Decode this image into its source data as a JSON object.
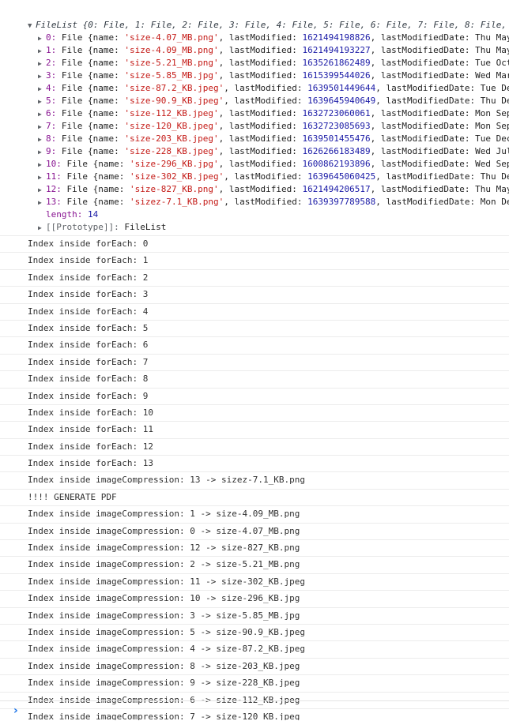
{
  "filelist": {
    "header": "FileList {0: File, 1: File, 2: File, 3: File, 4: File, 5: File, 6: File, 7: File, 8: File,",
    "entries": [
      {
        "index": "0",
        "name": "'size-4.07_MB.png'",
        "lastModified": "1621494198826",
        "date": "Thu May"
      },
      {
        "index": "1",
        "name": "'size-4.09_MB.png'",
        "lastModified": "1621494193227",
        "date": "Thu May"
      },
      {
        "index": "2",
        "name": "'size-5.21_MB.png'",
        "lastModified": "1635261862489",
        "date": "Tue Oct"
      },
      {
        "index": "3",
        "name": "'size-5.85_MB.jpg'",
        "lastModified": "1615399544026",
        "date": "Wed Mar"
      },
      {
        "index": "4",
        "name": "'size-87.2_KB.jpeg'",
        "lastModified": "1639501449644",
        "date": "Tue De"
      },
      {
        "index": "5",
        "name": "'size-90.9_KB.jpeg'",
        "lastModified": "1639645940649",
        "date": "Thu De"
      },
      {
        "index": "6",
        "name": "'size-112_KB.jpeg'",
        "lastModified": "1632723060061",
        "date": "Mon Sep"
      },
      {
        "index": "7",
        "name": "'size-120_KB.jpeg'",
        "lastModified": "1632723085693",
        "date": "Mon Sep"
      },
      {
        "index": "8",
        "name": "'size-203_KB.jpeg'",
        "lastModified": "1639501455476",
        "date": "Tue Dec"
      },
      {
        "index": "9",
        "name": "'size-228_KB.jpeg'",
        "lastModified": "1626266183489",
        "date": "Wed Jul"
      },
      {
        "index": "10",
        "name": "'size-296_KB.jpg'",
        "lastModified": "1600862193896",
        "date": "Wed Sep"
      },
      {
        "index": "11",
        "name": "'size-302_KB.jpeg'",
        "lastModified": "1639645060425",
        "date": "Thu De"
      },
      {
        "index": "12",
        "name": "'size-827_KB.png'",
        "lastModified": "1621494206517",
        "date": "Thu May"
      },
      {
        "index": "13",
        "name": "'sizez-7.1_KB.png'",
        "lastModified": "1639397789588",
        "date": "Mon De"
      }
    ],
    "length_label": "length:",
    "length_value": "14",
    "proto_label": "[[Prototype]]:",
    "proto_value": "FileList"
  },
  "logs": [
    "Index inside forEach: 0",
    "Index inside forEach: 1",
    "Index inside forEach: 2",
    "Index inside forEach: 3",
    "Index inside forEach: 4",
    "Index inside forEach: 5",
    "Index inside forEach: 6",
    "Index inside forEach: 7",
    "Index inside forEach: 8",
    "Index inside forEach: 9",
    "Index inside forEach: 10",
    "Index inside forEach: 11",
    "Index inside forEach: 12",
    "Index inside forEach: 13",
    "Index inside imageCompression: 13 -> sizez-7.1_KB.png",
    "!!!! GENERATE PDF",
    "Index inside imageCompression: 1 -> size-4.09_MB.png",
    "Index inside imageCompression: 0 -> size-4.07_MB.png",
    "Index inside imageCompression: 12 -> size-827_KB.png",
    "Index inside imageCompression: 2 -> size-5.21_MB.png",
    "Index inside imageCompression: 11 -> size-302_KB.jpeg",
    "Index inside imageCompression: 10 -> size-296_KB.jpg",
    "Index inside imageCompression: 3 -> size-5.85_MB.jpg",
    "Index inside imageCompression: 5 -> size-90.9_KB.jpeg",
    "Index inside imageCompression: 4 -> size-87.2_KB.jpeg",
    "Index inside imageCompression: 8 -> size-203_KB.jpeg",
    "Index inside imageCompression: 9 -> size-228_KB.jpeg",
    "Index inside imageCompression: 6 -> size-112_KB.jpeg",
    "Index inside imageCompression: 7 -> size-120_KB.jpeg"
  ],
  "prompt": {
    "caret": "›"
  },
  "colors": {
    "key": "#881391",
    "string": "#c41a16",
    "number": "#1a1aa6",
    "caret": "#1a73e8"
  }
}
